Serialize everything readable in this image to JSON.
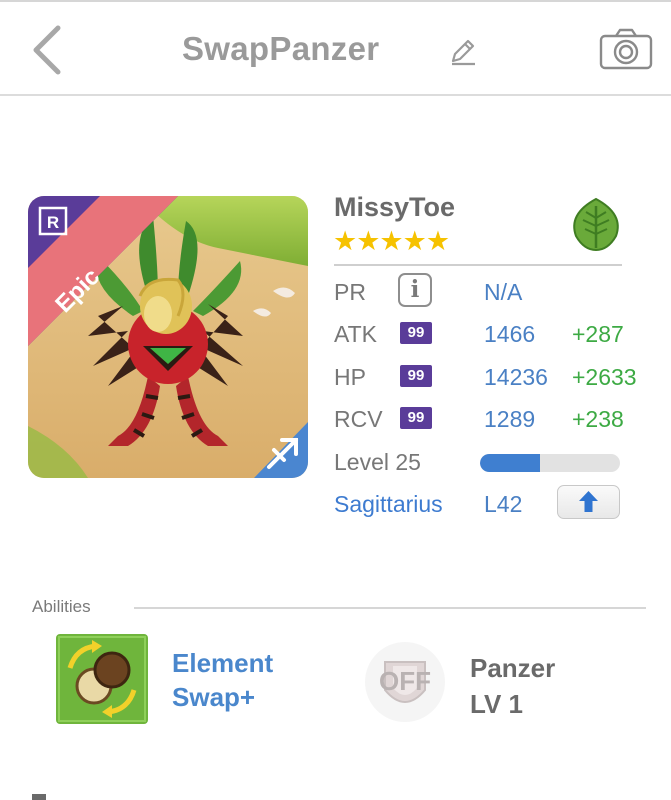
{
  "header": {
    "title": "SwapPanzer"
  },
  "monster": {
    "name": "MissyToe",
    "stars": "★★★★★",
    "rarity_tag": "Epic",
    "rarity_corner": "R",
    "element": "leaf-icon",
    "sign_icon": "sagittarius-arrow-icon"
  },
  "stats": {
    "pr": {
      "label": "PR",
      "value": "N/A"
    },
    "atk": {
      "label": "ATK",
      "badge": "99",
      "value": "1466",
      "bonus": "+287"
    },
    "hp": {
      "label": "HP",
      "badge": "99",
      "value": "14236",
      "bonus": "+2633"
    },
    "rcv": {
      "label": "RCV",
      "badge": "99",
      "value": "1289",
      "bonus": "+238"
    },
    "level": {
      "label": "Level 25",
      "progress_fraction": 0.43
    },
    "sign": {
      "label": "Sagittarius",
      "value": "L42"
    }
  },
  "abilities": {
    "section_label": "Abilities",
    "ability_line1": "Element",
    "ability_line2": "Swap+",
    "toggle_label": "OFF",
    "panzer_line1": "Panzer",
    "panzer_line2": "LV 1"
  },
  "colors": {
    "accent_blue": "#4a80c4",
    "bonus_green": "#3daa44",
    "star_gold": "#f6c200",
    "badge_purple": "#5a3c99",
    "epic_banner": "#e8737a"
  }
}
